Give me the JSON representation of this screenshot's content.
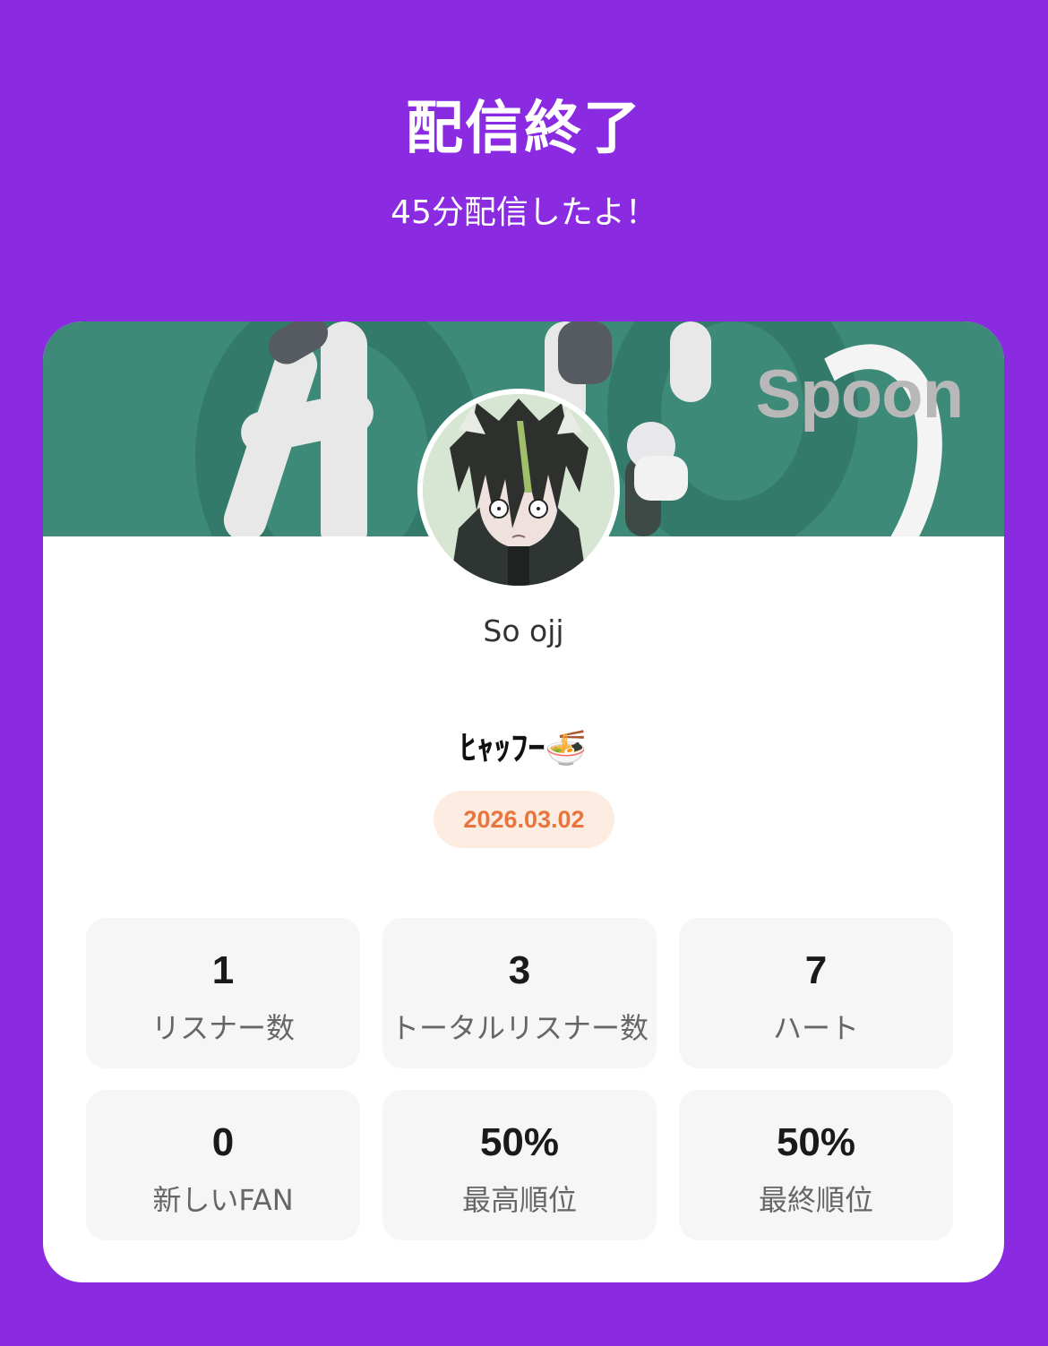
{
  "header": {
    "title": "配信終了",
    "subtitle": "45分配信したよ！"
  },
  "banner": {
    "logo_text": "Spoon",
    "background_color": "#3d8a78"
  },
  "profile": {
    "username": "So ojj"
  },
  "broadcast": {
    "title": "ﾋｬｯﾌｰ🍜",
    "date": "2026.03.02"
  },
  "stats": [
    {
      "value": "1",
      "label": "リスナー数"
    },
    {
      "value": "3",
      "label": "トータルリスナー数"
    },
    {
      "value": "7",
      "label": "ハート"
    },
    {
      "value": "0",
      "label": "新しいFAN"
    },
    {
      "value": "50%",
      "label": "最高順位"
    },
    {
      "value": "50%",
      "label": "最終順位"
    }
  ],
  "colors": {
    "page_background": "#8a2be2",
    "date_text": "#e7753d",
    "date_background": "#fdece2"
  }
}
